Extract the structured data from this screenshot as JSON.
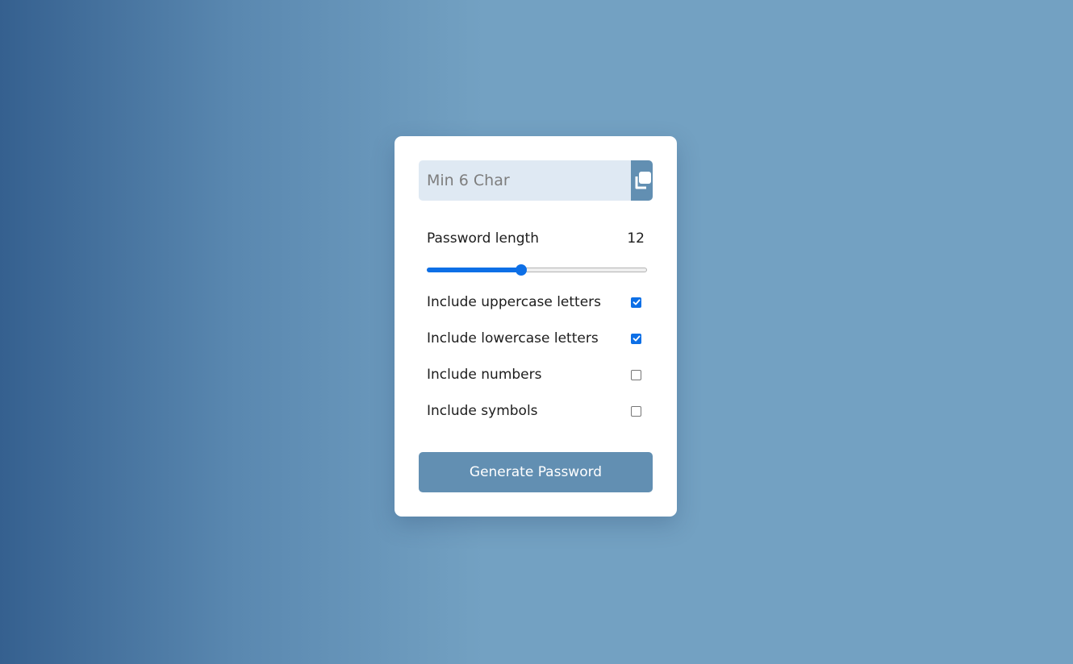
{
  "password_field": {
    "value": "",
    "placeholder": "Min 6 Char"
  },
  "copy_button": {
    "icon": "copy-icon"
  },
  "length": {
    "label": "Password length",
    "value": "12",
    "slider_min": 6,
    "slider_max": 32,
    "slider_value": 12,
    "slider_fill_fraction": 0.43
  },
  "options": [
    {
      "label": "Include uppercase letters",
      "checked": true
    },
    {
      "label": "Include lowercase letters",
      "checked": true
    },
    {
      "label": "Include numbers",
      "checked": false
    },
    {
      "label": "Include symbols",
      "checked": false
    }
  ],
  "generate_button": {
    "label": "Generate Password"
  },
  "colors": {
    "accent": "#628fb2",
    "checkbox": "#0d6fe6",
    "input_bg": "#dfe9f3"
  }
}
